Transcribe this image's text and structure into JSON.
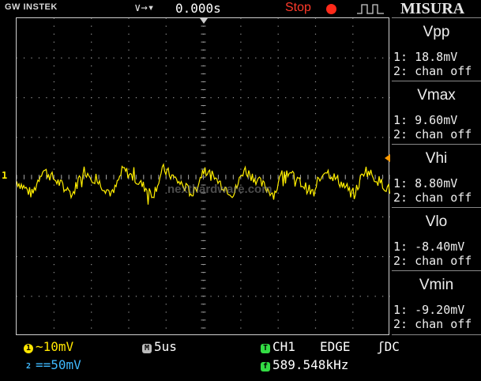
{
  "header": {
    "brand": "GW INSTEK",
    "time_position": "0.000s",
    "run_status": "Stop",
    "overlay_title": "MISURA"
  },
  "waveform": {
    "channel_marker": "1",
    "watermark": "nexthardware.com",
    "trace_color": "#ffee00",
    "trigger_level_color": "#ff9900"
  },
  "measurements": [
    {
      "name": "Vpp",
      "ch1": "1: 18.8mV",
      "ch2": "2: chan off"
    },
    {
      "name": "Vmax",
      "ch1": "1: 9.60mV",
      "ch2": "2: chan off"
    },
    {
      "name": "Vhi",
      "ch1": "1: 8.80mV",
      "ch2": "2: chan off"
    },
    {
      "name": "Vlo",
      "ch1": "1: -8.40mV",
      "ch2": "2: chan off"
    },
    {
      "name": "Vmin",
      "ch1": "1: -9.20mV",
      "ch2": "2: chan off"
    }
  ],
  "status": {
    "ch1_badge": "1",
    "ch1_coupling": "~",
    "ch1_scale": "10mV",
    "ch2_badge": "2",
    "ch2_coupling": "==",
    "ch2_scale": "50mV",
    "timebase_badge": "M",
    "timebase": "5us",
    "trigger_badge": "T",
    "trigger_source": "CH1",
    "trigger_type": "EDGE",
    "trigger_coupling": "DC",
    "freq_badge": "f",
    "frequency": "589.548kHz"
  }
}
